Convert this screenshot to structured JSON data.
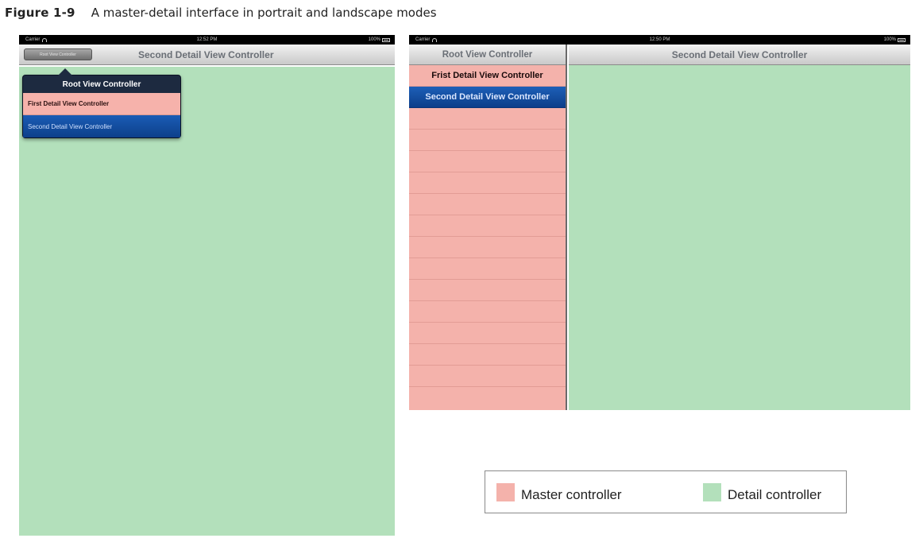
{
  "caption": {
    "number": "Figure 1-9",
    "text": "A master-detail interface in portrait and landscape modes"
  },
  "colors": {
    "master": "#f4b2ab",
    "detail": "#b3e0bb",
    "selected": "#1552a8"
  },
  "portrait": {
    "statusbar": {
      "carrier": "Carrier",
      "time": "12:52 PM",
      "battery": "100%"
    },
    "navbar": {
      "button_label": "Root View Controller",
      "title": "Second Detail View Controller"
    },
    "popover": {
      "title": "Root View Controller",
      "items": [
        {
          "label": "First Detail View Controller"
        },
        {
          "label": "Second Detail View Controller"
        }
      ]
    }
  },
  "landscape": {
    "statusbar": {
      "carrier": "Carrier",
      "time": "12:50 PM",
      "battery": "100%"
    },
    "master_title": "Root View Controller",
    "detail_title": "Second Detail View Controller",
    "items": [
      {
        "label": "Frist Detail View Controller"
      },
      {
        "label": "Second Detail View Controller"
      }
    ]
  },
  "legend": {
    "master_label": "Master controller",
    "detail_label": "Detail controller"
  }
}
